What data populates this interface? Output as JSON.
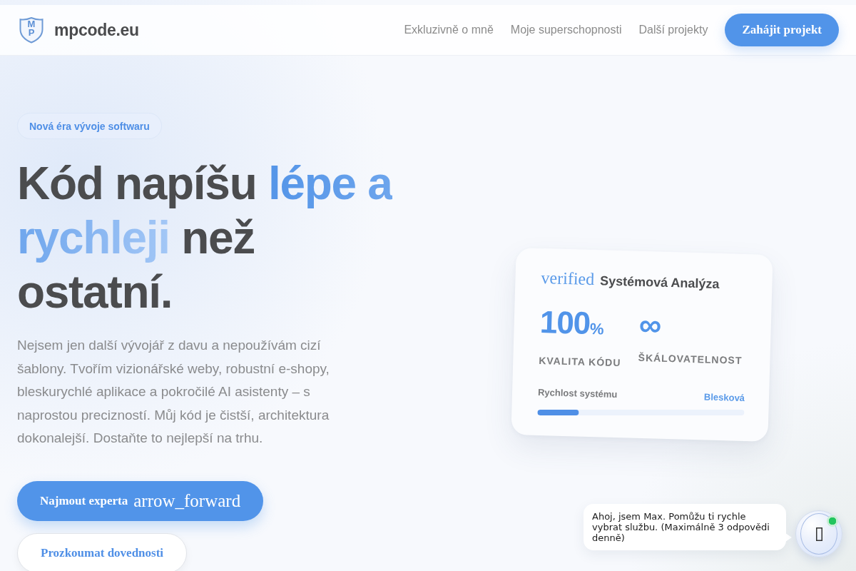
{
  "header": {
    "logo": {
      "monogram": [
        "M",
        "P"
      ],
      "name": "mpcode.eu"
    },
    "nav": [
      "Exkluzivně o mně",
      "Moje superschopnosti",
      "Další projekty"
    ],
    "cta": "Zahájit projekt"
  },
  "hero": {
    "badge": "Nová éra vývoje softwaru",
    "heading": [
      {
        "text": "Kód napíšu ",
        "accent": false
      },
      {
        "text": "lépe a rychleji",
        "accent": true
      },
      {
        "text": " než ostatní.",
        "accent": false
      }
    ],
    "description": "Nejsem jen další vývojář z davu a nepoužívám cizí šablony. Tvořím vizionářské weby, robustní e-shopy, bleskurychlé aplikace a pokročilé AI asistenty – s naprostou precizností. Můj kód je čistší, architektura dokonalejší. Dostaňte to nejlepší na trhu.",
    "buttons": [
      {
        "kind": "primary",
        "label": "Najmout experta",
        "icon_text": "arrow_forward"
      },
      {
        "kind": "secondary",
        "label": "Prozkoumat dovednosti"
      }
    ]
  },
  "card": {
    "icon_text": "verified",
    "title": "Systémová Analýza",
    "stats": [
      {
        "value": "100",
        "unit": "%",
        "label": "KVALITA KÓDU"
      },
      {
        "value": "∞",
        "label": "ŠKÁLOVATELNOST"
      }
    ],
    "progress": {
      "label": "Rychlost systému",
      "reading": "Blesková",
      "level": 0.2
    }
  },
  "chat": {
    "message": "Ahoj, jsem Max. Pomůžu ti rychle vybrat službu. (Maximálně 3 odpovědi denně)",
    "online": true
  }
}
